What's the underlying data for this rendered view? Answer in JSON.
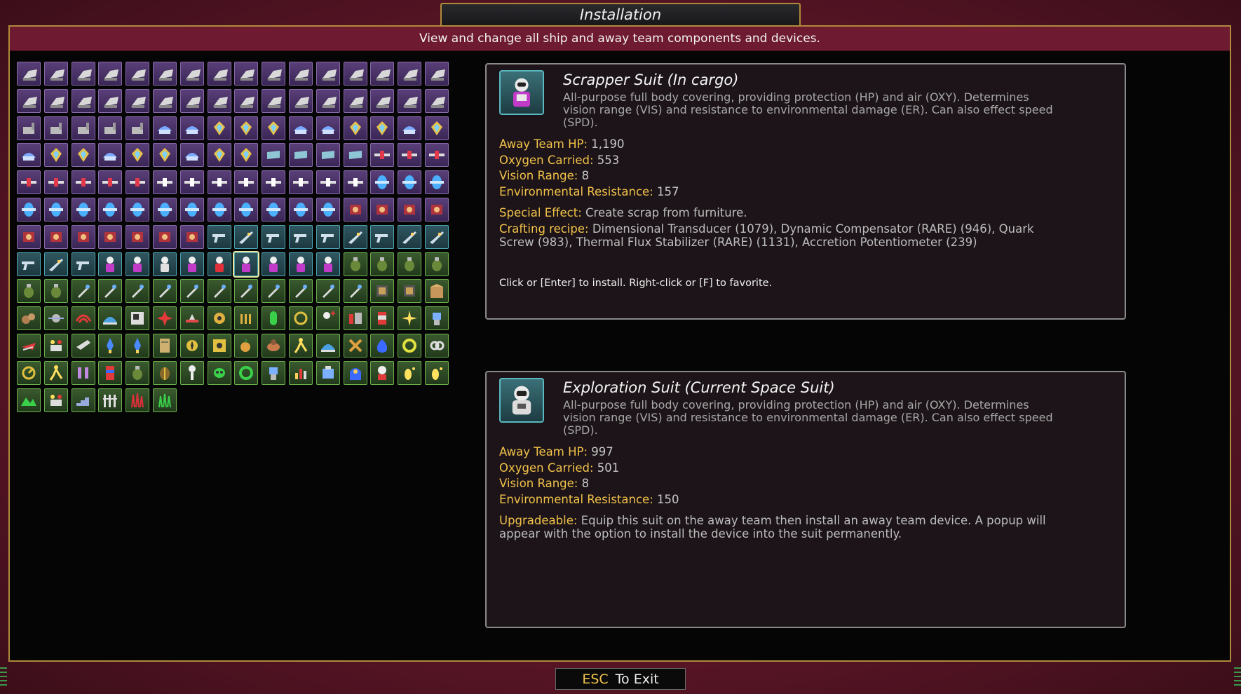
{
  "window": {
    "title": "Installation",
    "subtitle": "View and change all ship and away team components and devices."
  },
  "grid": {
    "rows": [
      {
        "style": "purple",
        "icons": [
          "turret-icon",
          "turret-icon",
          "turret-icon",
          "turret-icon",
          "turret-icon",
          "turret-icon",
          "turret-icon",
          "turret-icon",
          "turret-icon",
          "turret-icon",
          "turret-icon",
          "turret-icon",
          "turret-icon",
          "turret-icon",
          "turret-icon",
          "turret-icon"
        ]
      },
      {
        "style": "purple",
        "icons": [
          "turret-icon",
          "turret-icon",
          "turret-icon",
          "turret-icon",
          "turret-icon",
          "turret-icon",
          "turret-icon",
          "turret-icon",
          "turret-icon",
          "turret-icon",
          "turret-icon",
          "turret-icon",
          "turret-icon",
          "turret-icon",
          "turret-icon",
          "turret-icon"
        ]
      },
      {
        "style": "purple",
        "icons": [
          "cannon-icon",
          "cannon-icon",
          "cannon-icon",
          "cannon-icon",
          "cannon-icon",
          "shield-generator-icon",
          "shield-generator-icon",
          "crystal-icon",
          "crystal-icon",
          "crystal-icon",
          "shield-generator-icon",
          "shield-generator-icon",
          "crystal-icon",
          "crystal-icon",
          "shield-generator-icon",
          "crystal-icon"
        ]
      },
      {
        "style": "purple",
        "icons": [
          "shield-generator-icon",
          "crystal-icon",
          "crystal-icon",
          "shield-generator-icon",
          "crystal-icon",
          "crystal-icon",
          "shield-generator-icon",
          "crystal-icon",
          "crystal-icon",
          "armor-plate-icon",
          "armor-plate-icon",
          "armor-plate-icon",
          "armor-plate-icon",
          "engine-red-icon",
          "engine-red-icon",
          "engine-red-icon"
        ]
      },
      {
        "style": "purple",
        "icons": [
          "engine-red-icon",
          "engine-red-icon",
          "engine-red-icon",
          "engine-red-icon",
          "engine-red-icon",
          "engine-white-icon",
          "engine-white-icon",
          "engine-white-icon",
          "engine-white-icon",
          "engine-white-icon",
          "engine-white-icon",
          "engine-white-icon",
          "engine-white-icon",
          "pod-blue-icon",
          "pod-blue-icon",
          "pod-blue-icon"
        ]
      },
      {
        "style": "purple",
        "icons": [
          "pod-blue-icon",
          "pod-blue-icon",
          "pod-blue-icon",
          "pod-blue-icon",
          "pod-blue-icon",
          "pod-blue-icon",
          "pod-blue-icon",
          "pod-blue-icon",
          "pod-blue-icon",
          "pod-blue-icon",
          "pod-blue-icon",
          "pod-blue-icon",
          "reactor-icon",
          "reactor-icon",
          "reactor-icon",
          "reactor-icon"
        ]
      },
      {
        "style": "mixed",
        "icons": [
          "reactor-icon",
          "reactor-icon",
          "reactor-icon",
          "reactor-icon",
          "reactor-icon",
          "reactor-icon",
          "reactor-icon",
          "pistol-icon",
          "rifle-icon",
          "pistol-icon",
          "pistol-icon",
          "pistol-icon",
          "rifle-icon",
          "pistol-icon",
          "rifle-icon",
          "rifle-icon"
        ]
      },
      {
        "style": "mixed",
        "icons": [
          "pistol-icon",
          "rifle-icon",
          "pistol-icon",
          "suit-purple-icon",
          "suit-purple-icon",
          "suit-white-icon",
          "suit-purple-icon",
          "suit-red-icon",
          "suit-purple-icon",
          "suit-purple-icon",
          "suit-purple-icon",
          "suit-purple-icon",
          "grenade-icon",
          "grenade-icon",
          "grenade-icon",
          "grenade-icon"
        ]
      },
      {
        "style": "green",
        "icons": [
          "grenade-icon",
          "grenade-icon",
          "tool-icon",
          "tool-icon",
          "tool-icon",
          "tool-icon",
          "tool-icon",
          "tool-icon",
          "tool-icon",
          "tool-icon",
          "tool-icon",
          "tool-icon",
          "tool-icon",
          "chip-icon",
          "chip-icon",
          "crate-icon"
        ]
      },
      {
        "style": "green",
        "icons": [
          "rocks-icon",
          "drone-icon",
          "radar-icon",
          "dome-icon",
          "scanner-icon",
          "star-icon",
          "platform-icon",
          "gear-icon",
          "bars-icon",
          "capsule-icon",
          "cycle-icon",
          "medic-icon",
          "hazard-icon",
          "canister-icon",
          "sparkle-icon",
          "robot-icon"
        ]
      },
      {
        "style": "green",
        "icons": [
          "ship-icon",
          "people-icon",
          "arrow-icon",
          "rocket-icon",
          "rocket-icon",
          "document-icon",
          "compass-icon",
          "radiation-icon",
          "fruit-icon",
          "creature-icon",
          "runner-icon",
          "dome-icon",
          "crosshair-icon",
          "blob-icon",
          "ring-icon",
          "link-icon"
        ]
      },
      {
        "style": "green",
        "icons": [
          "gauge-icon",
          "runner-icon",
          "vials-icon",
          "cylinder-icon",
          "grenade-icon",
          "beetle-icon",
          "skeleton-icon",
          "mask-icon",
          "biohazard-icon",
          "robot-icon",
          "chart-icon",
          "lab-icon",
          "ghost-icon",
          "astronaut-icon",
          "foot-icon",
          "foot-icon"
        ]
      },
      {
        "style": "green",
        "icons": [
          "terrain-icon",
          "people-icon",
          "stairs-icon",
          "fence-icon",
          "red-grass-icon",
          "green-grass-icon"
        ]
      }
    ]
  },
  "card1": {
    "title": "Scrapper Suit (In cargo)",
    "description": "All-purpose full body covering, providing protection (HP) and air (OXY). Determines vision range (VIS) and resistance to environmental damage (ER). Can also effect speed (SPD).",
    "stats": [
      {
        "label": "Away Team HP",
        "value": "1,190"
      },
      {
        "label": "Oxygen Carried",
        "value": "553"
      },
      {
        "label": "Vision Range",
        "value": "8"
      },
      {
        "label": "Environmental Resistance",
        "value": "157"
      }
    ],
    "special_label": "Special Effect",
    "special_value": "Create scrap from furniture.",
    "recipe_label": "Crafting recipe",
    "recipe_value": "Dimensional Transducer (1079), Dynamic Compensator (RARE)  (946), Quark Screw (983), Thermal Flux Stabilizer (RARE)  (1131), Accretion Potentiometer (239)",
    "hint": "Click or [Enter] to install.  Right-click or [F] to favorite."
  },
  "card2": {
    "title": "Exploration Suit (Current Space Suit)",
    "description": "All-purpose full body covering, providing protection (HP) and air (OXY). Determines vision range (VIS) and resistance to environmental damage (ER). Can also effect speed (SPD).",
    "stats": [
      {
        "label": "Away Team HP",
        "value": "997"
      },
      {
        "label": "Oxygen Carried",
        "value": "501"
      },
      {
        "label": "Vision Range",
        "value": "8"
      },
      {
        "label": "Environmental Resistance",
        "value": "150"
      }
    ],
    "upgrade_label": "Upgradeable",
    "upgrade_value": "Equip this suit on the away team then install an away team device. A popup will appear with the option to install the device into the suit permanently."
  },
  "footer": {
    "key": "ESC",
    "label": "To Exit"
  },
  "colors": {
    "accent": "#f2c24a",
    "frame": "#b08a3a",
    "banner": "#6e1a30"
  }
}
